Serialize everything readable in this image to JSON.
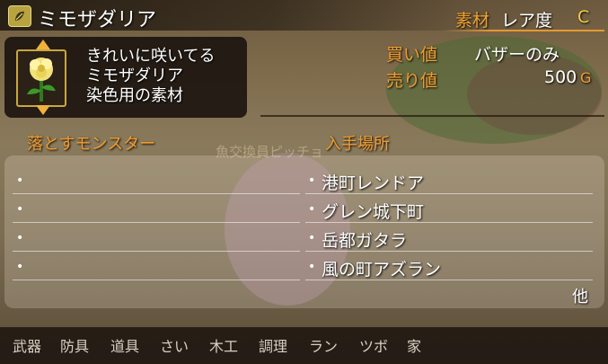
{
  "header": {
    "title": "ミモザダリア",
    "title_icon": "leaf-emblem-icon",
    "rarity": {
      "category": "素材",
      "label": "レア度",
      "grade": "C"
    }
  },
  "item": {
    "icon": "yellow-flower-icon",
    "description": [
      "きれいに咲いてる",
      "ミモザダリア",
      "染色用の素材"
    ]
  },
  "prices": {
    "buy_label": "買い値",
    "buy_value": "バザーのみ",
    "sell_label": "売り値",
    "sell_value": "500",
    "sell_unit": "G"
  },
  "sections": {
    "monsters_label": "落とすモンスター",
    "locations_label": "入手場所",
    "background_sign": "魚交換員ピッチョ"
  },
  "locations": [
    "港町レンドア",
    "グレン城下町",
    "岳都ガタラ",
    "風の町アズラン"
  ],
  "more_label": "他",
  "tabs": [
    "武器",
    "防具",
    "道具",
    "さい",
    "木工",
    "調理",
    "ラン",
    "ツボ",
    "家"
  ],
  "colors": {
    "accent_orange": "#f29c2e",
    "rarity_yellow": "#f4c94a",
    "text_white": "#ffffff"
  }
}
